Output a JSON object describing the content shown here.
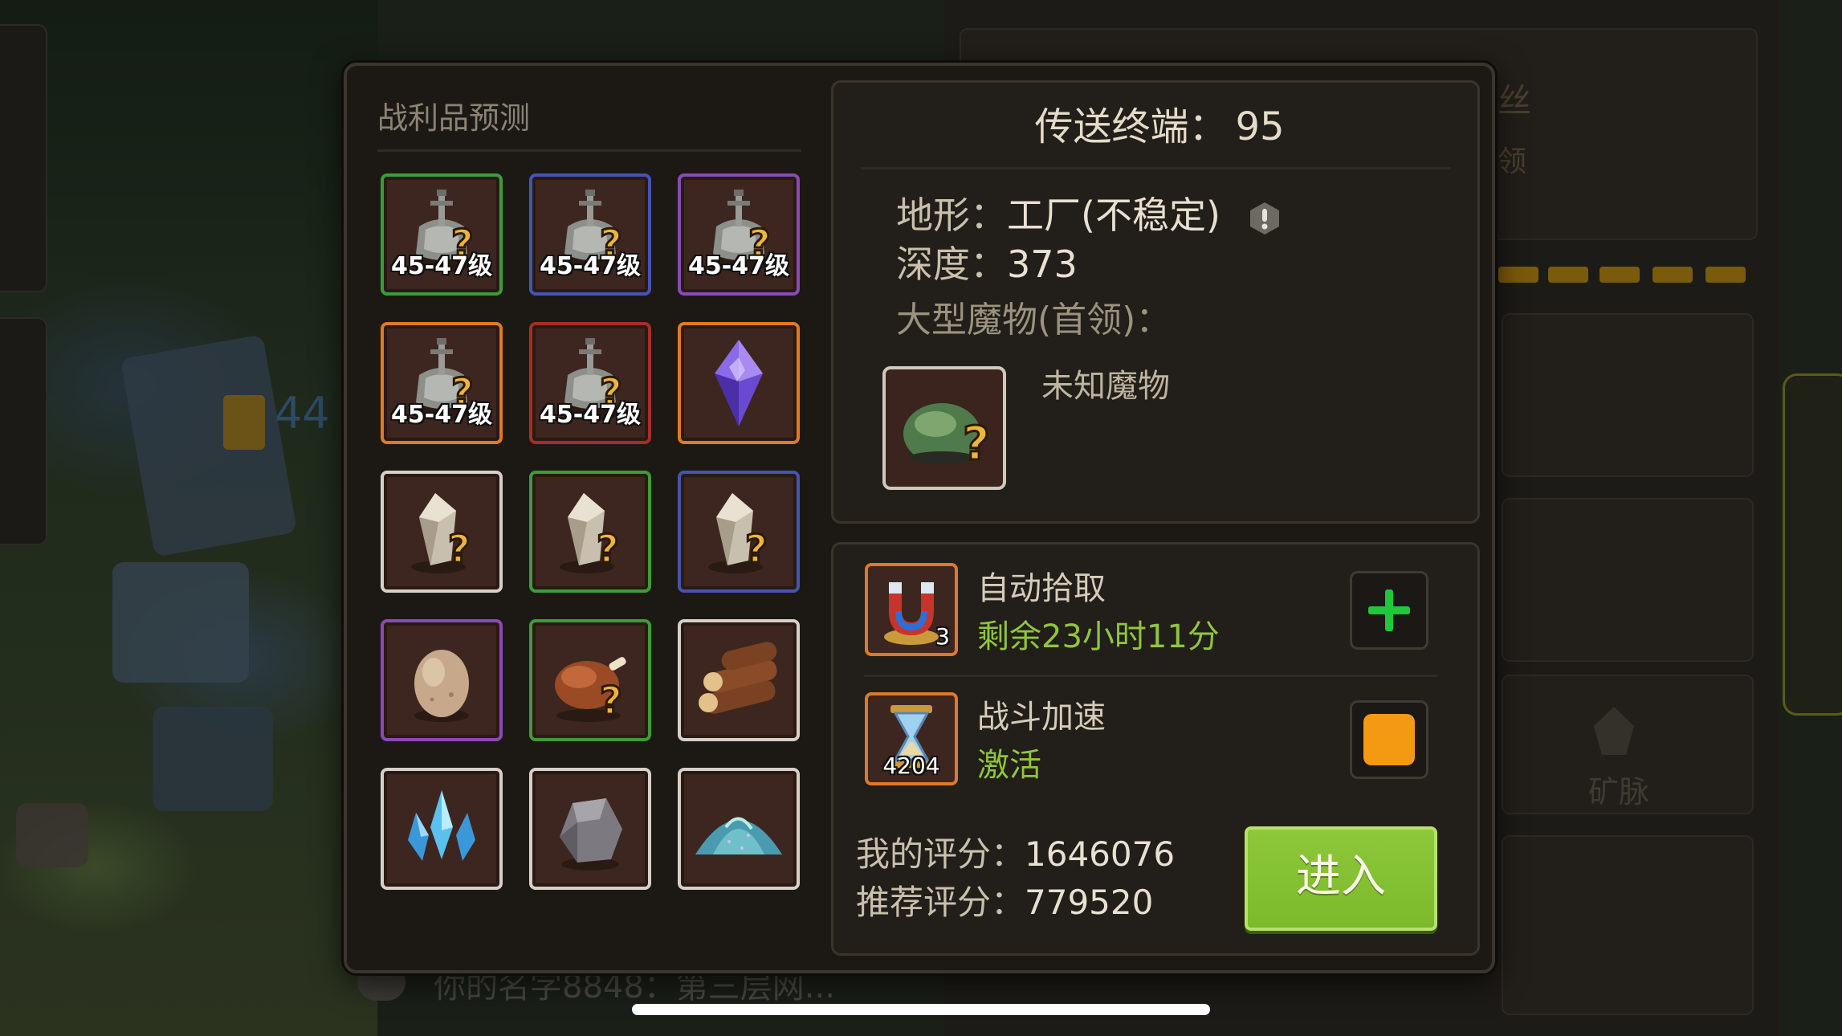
{
  "background": {
    "chat_text": "你的名字8848：第三层网...",
    "faint_label_top": "丝",
    "faint_label_sub": "领",
    "mine_label": "矿脉",
    "left_number": "44"
  },
  "loot": {
    "title": "战利品预测",
    "items": [
      {
        "icon": "armor-mystery-icon",
        "rarity": "green",
        "label": "45-47级"
      },
      {
        "icon": "armor-mystery-icon",
        "rarity": "blue",
        "label": "45-47级"
      },
      {
        "icon": "armor-mystery-icon",
        "rarity": "purple",
        "label": "45-47级"
      },
      {
        "icon": "armor-mystery-icon",
        "rarity": "orange",
        "label": "45-47级"
      },
      {
        "icon": "armor-mystery-icon",
        "rarity": "red",
        "label": "45-47级"
      },
      {
        "icon": "purple-crystal-icon",
        "rarity": "orange",
        "label": ""
      },
      {
        "icon": "crystal-mystery-icon",
        "rarity": "white",
        "label": ""
      },
      {
        "icon": "crystal-mystery-icon",
        "rarity": "green",
        "label": ""
      },
      {
        "icon": "crystal-mystery-icon",
        "rarity": "blue",
        "label": ""
      },
      {
        "icon": "egg-icon",
        "rarity": "purple",
        "label": ""
      },
      {
        "icon": "roast-chicken-mystery-icon",
        "rarity": "green",
        "label": ""
      },
      {
        "icon": "wood-logs-icon",
        "rarity": "white",
        "label": ""
      },
      {
        "icon": "blue-crystal-cluster-icon",
        "rarity": "white",
        "label": ""
      },
      {
        "icon": "stone-ore-icon",
        "rarity": "white",
        "label": ""
      },
      {
        "icon": "sand-pile-icon",
        "rarity": "white",
        "label": ""
      }
    ]
  },
  "terminal": {
    "title_label": "传送终端：",
    "title_value": "95",
    "terrain_label": "地形：",
    "terrain_value": "工厂(不稳定)",
    "depth_label": "深度：",
    "depth_value": "373",
    "boss_label": "大型魔物(首领)：",
    "boss_name": "未知魔物"
  },
  "boosts": {
    "auto_pickup": {
      "name": "自动拾取",
      "status": "剩余23小时11分",
      "count": "3"
    },
    "battle_speed": {
      "name": "战斗加速",
      "status": "激活",
      "count": "4204"
    }
  },
  "score": {
    "my_label": "我的评分：",
    "my_value": "1646076",
    "rec_label": "推荐评分：",
    "rec_value": "779520"
  },
  "enter_button": "进入",
  "colors": {
    "rarity_green": "#3e9b3a",
    "rarity_blue": "#4455b0",
    "rarity_purple": "#8c49b6",
    "rarity_orange": "#e07a22",
    "rarity_red": "#a82d27",
    "status_green": "#8fc63d",
    "enter_green": "#7cb92b",
    "toggle_orange": "#f39a12"
  }
}
